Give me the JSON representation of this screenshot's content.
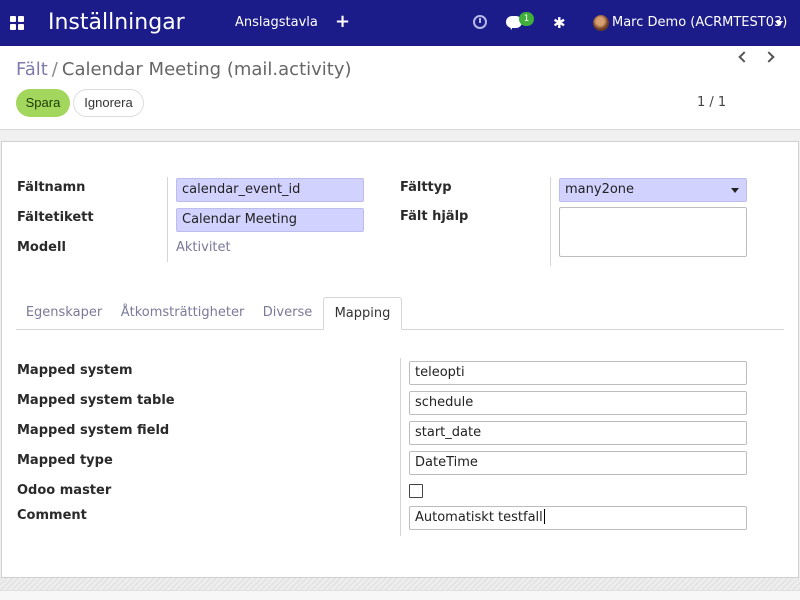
{
  "navbar": {
    "app_title": "Inställningar",
    "menu_item": "Anslagstavla",
    "plus_icon": "+",
    "chat_badge": "1",
    "bug_icon": "✱",
    "user": "Marc Demo (ACRMTEST03)"
  },
  "breadcrumb": {
    "parent": "Fält",
    "separator": "/",
    "current": "Calendar Meeting (mail.activity)"
  },
  "buttons": {
    "save": "Spara",
    "discard": "Ignorera"
  },
  "pager": {
    "text": "1 / 1"
  },
  "form": {
    "field_name_label": "Fältnamn",
    "field_name_value": "calendar_event_id",
    "field_label_label": "Fältetikett",
    "field_label_value": "Calendar Meeting",
    "model_label": "Modell",
    "model_value": "Aktivitet",
    "field_type_label": "Fälttyp",
    "field_type_value": "many2one",
    "field_help_label": "Fält hjälp",
    "field_help_value": ""
  },
  "tabs": [
    {
      "label": "Egenskaper"
    },
    {
      "label": "Åtkomsträttigheter"
    },
    {
      "label": "Diverse"
    },
    {
      "label": "Mapping"
    }
  ],
  "active_tab": "Mapping",
  "mapping": {
    "mapped_system_label": "Mapped system",
    "mapped_system_value": "teleopti",
    "mapped_system_table_label": "Mapped system table",
    "mapped_system_table_value": "schedule",
    "mapped_system_field_label": "Mapped system field",
    "mapped_system_field_value": "start_date",
    "mapped_type_label": "Mapped type",
    "mapped_type_value": "DateTime",
    "odoo_master_label": "Odoo master",
    "odoo_master_checked": false,
    "comment_label": "Comment",
    "comment_value": "Automatiskt testfall"
  },
  "colors": {
    "navbar": "#1b1b8a",
    "save_button": "#a3d65c",
    "highlight_input": "#d2d2ff",
    "badge": "#3fae3a"
  }
}
